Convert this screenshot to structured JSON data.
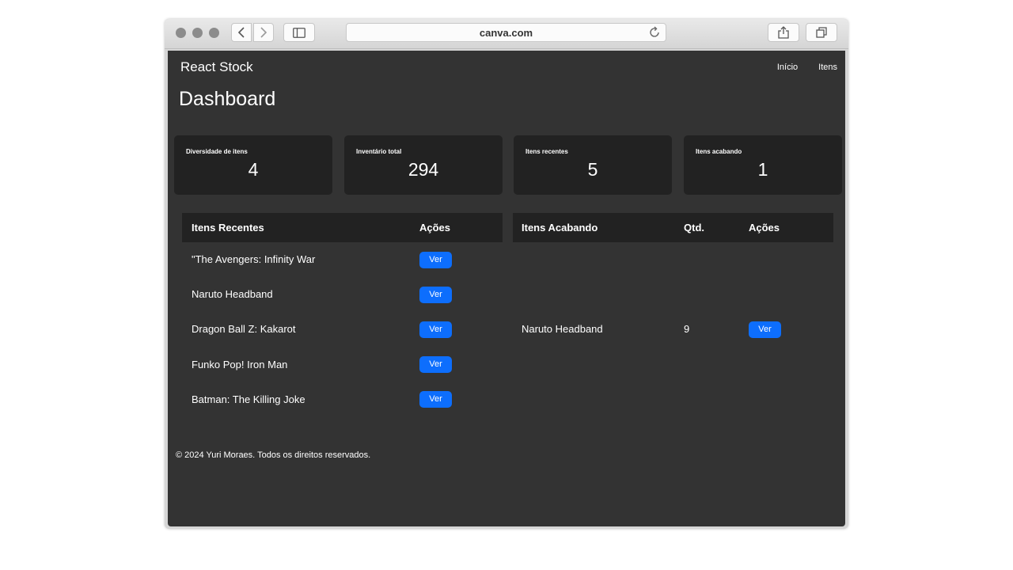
{
  "browser": {
    "url": "canva.com",
    "icons": [
      "back-icon",
      "forward-icon",
      "sidebar-icon",
      "reload-icon",
      "share-icon",
      "tabs-icon"
    ]
  },
  "navbar": {
    "brand": "React Stock",
    "links": [
      "Início",
      "Itens"
    ]
  },
  "page_title": "Dashboard",
  "stats": [
    {
      "label": "Diversidade de itens",
      "value": "4"
    },
    {
      "label": "Inventário total",
      "value": "294"
    },
    {
      "label": "Itens recentes",
      "value": "5"
    },
    {
      "label": "Itens acabando",
      "value": "1"
    }
  ],
  "recent_table": {
    "headers": [
      "Itens Recentes",
      "Ações"
    ],
    "rows": [
      {
        "name": "\"The Avengers: Infinity War",
        "action": "Ver"
      },
      {
        "name": "Naruto Headband",
        "action": "Ver"
      },
      {
        "name": "Dragon Ball Z: Kakarot",
        "action": "Ver"
      },
      {
        "name": "Funko Pop! Iron Man",
        "action": "Ver"
      },
      {
        "name": "Batman: The Killing Joke",
        "action": "Ver"
      }
    ]
  },
  "low_table": {
    "headers": [
      "Itens Acabando",
      "Qtd.",
      "Ações"
    ],
    "rows": [
      {
        "name": "Naruto Headband",
        "qty": "9",
        "action": "Ver"
      }
    ]
  },
  "footer": "© 2024 Yuri Moraes. Todos os direitos reservados.",
  "colors": {
    "page_bg": "#333333",
    "card_bg": "#222222",
    "button": "#0d6efd"
  }
}
